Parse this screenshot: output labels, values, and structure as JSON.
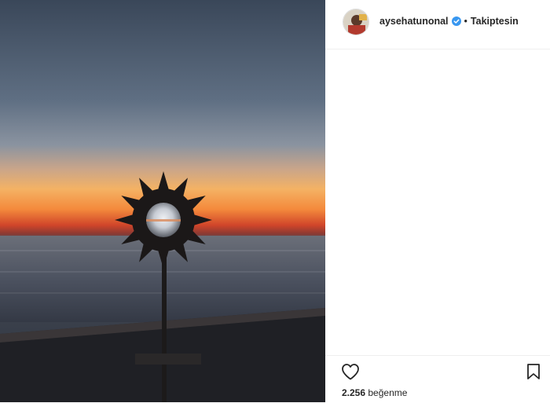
{
  "post": {
    "username": "aysehatunonal",
    "separator": "•",
    "follow_label": "Takiptesin",
    "likes_count": "2.256",
    "likes_label": "beğenme"
  },
  "icons": {
    "avatar": "avatar",
    "verified": "verified-badge-icon",
    "like": "heart-icon",
    "save": "bookmark-icon"
  },
  "colors": {
    "verified_blue": "#3897f0",
    "text": "#262626",
    "divider": "#efefef"
  }
}
